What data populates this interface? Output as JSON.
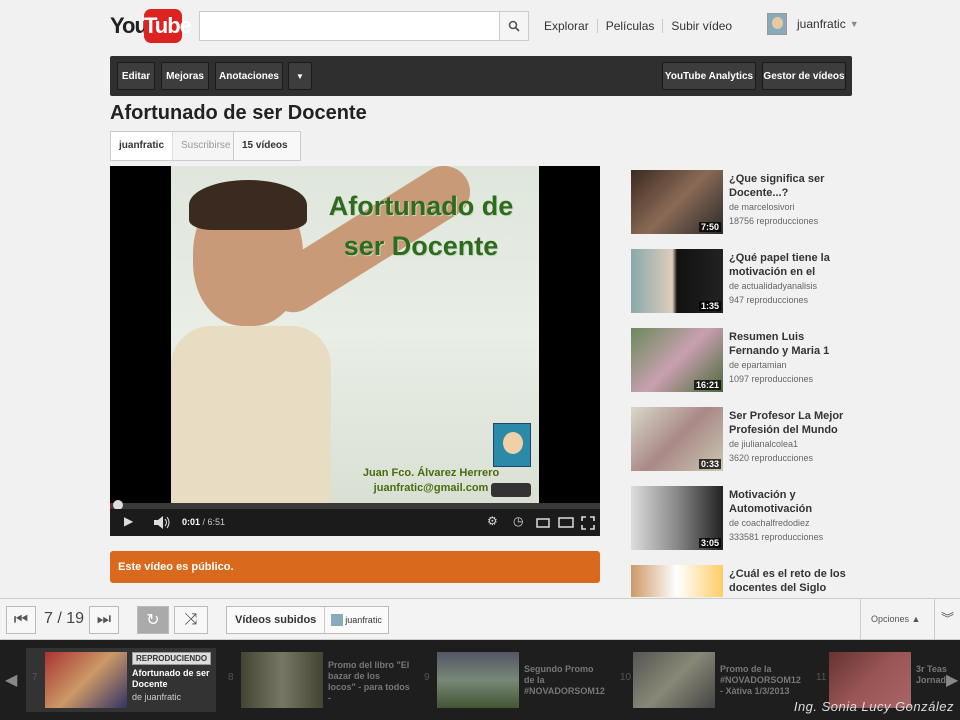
{
  "header": {
    "logo_you": "You",
    "logo_tube": "Tube",
    "search_placeholder": "",
    "nav": [
      "Explorar",
      "Películas",
      "Subir vídeo"
    ],
    "username": "juanfratic"
  },
  "owner_bar": {
    "editar": "Editar",
    "mejoras": "Mejoras",
    "anotaciones": "Anotaciones",
    "analytics": "YouTube Analytics",
    "gestor": "Gestor de vídeos"
  },
  "video": {
    "title": "Afortunado de ser Docente",
    "channel": "juanfratic",
    "subscribe": "Suscribirse",
    "videos_count": "15 vídeos",
    "frame_title": "Afortunado de ser Docente",
    "frame_author": "Juan Fco. Álvarez Herrero",
    "frame_email": "juanfratic@gmail.com",
    "time_current": "0:01",
    "time_total": "6:51",
    "progress": 0.002,
    "public_notice": "Este vídeo es público."
  },
  "related": [
    {
      "title": "¿Que significa ser Docente...?",
      "by": "de marcelosivori",
      "views": "18756 reproducciones",
      "duration": "7:50"
    },
    {
      "title": "¿Qué papel tiene la motivación en el",
      "by": "de actualidadyanalisis",
      "views": "947 reproducciones",
      "duration": "1:35"
    },
    {
      "title": "Resumen Luis Fernando y Maria 1",
      "by": "de epartamian",
      "views": "1097 reproducciones",
      "duration": "16:21"
    },
    {
      "title": "Ser Profesor La Mejor Profesión del Mundo",
      "by": "de jiulianalcolea1",
      "views": "3620 reproducciones",
      "duration": "0:33"
    },
    {
      "title": "Motivación y Automotivación",
      "by": "de coachalfredodiez",
      "views": "333581 reproducciones",
      "duration": "3:05"
    },
    {
      "title": "¿Cuál es el reto de los docentes del Siglo",
      "by": "",
      "views": "",
      "duration": ""
    }
  ],
  "playlist_bar": {
    "count": "7 / 19",
    "uploaded": "Vídeos subidos",
    "user": "juanfratic",
    "options": "Opciones"
  },
  "playlist": [
    {
      "num": "7",
      "title": "Afortunado de ser Docente",
      "by": "de juanfratic",
      "badge": "REPRODUCIENDO"
    },
    {
      "num": "8",
      "title": "Promo del libro \"El bazar de los locos\" - para todos -"
    },
    {
      "num": "9",
      "title": "Segundo Promo de la #NOVADORSOM12"
    },
    {
      "num": "10",
      "title": "Promo de la #NOVADORSOM12 - Xàtiva 1/3/2013"
    },
    {
      "num": "11",
      "title": "3r Teas Jornad"
    }
  ],
  "credit": "Ing. Sonia Lucy González",
  "colors": {
    "public_bar": "#d9691c",
    "logo_red": "#dd2222"
  }
}
